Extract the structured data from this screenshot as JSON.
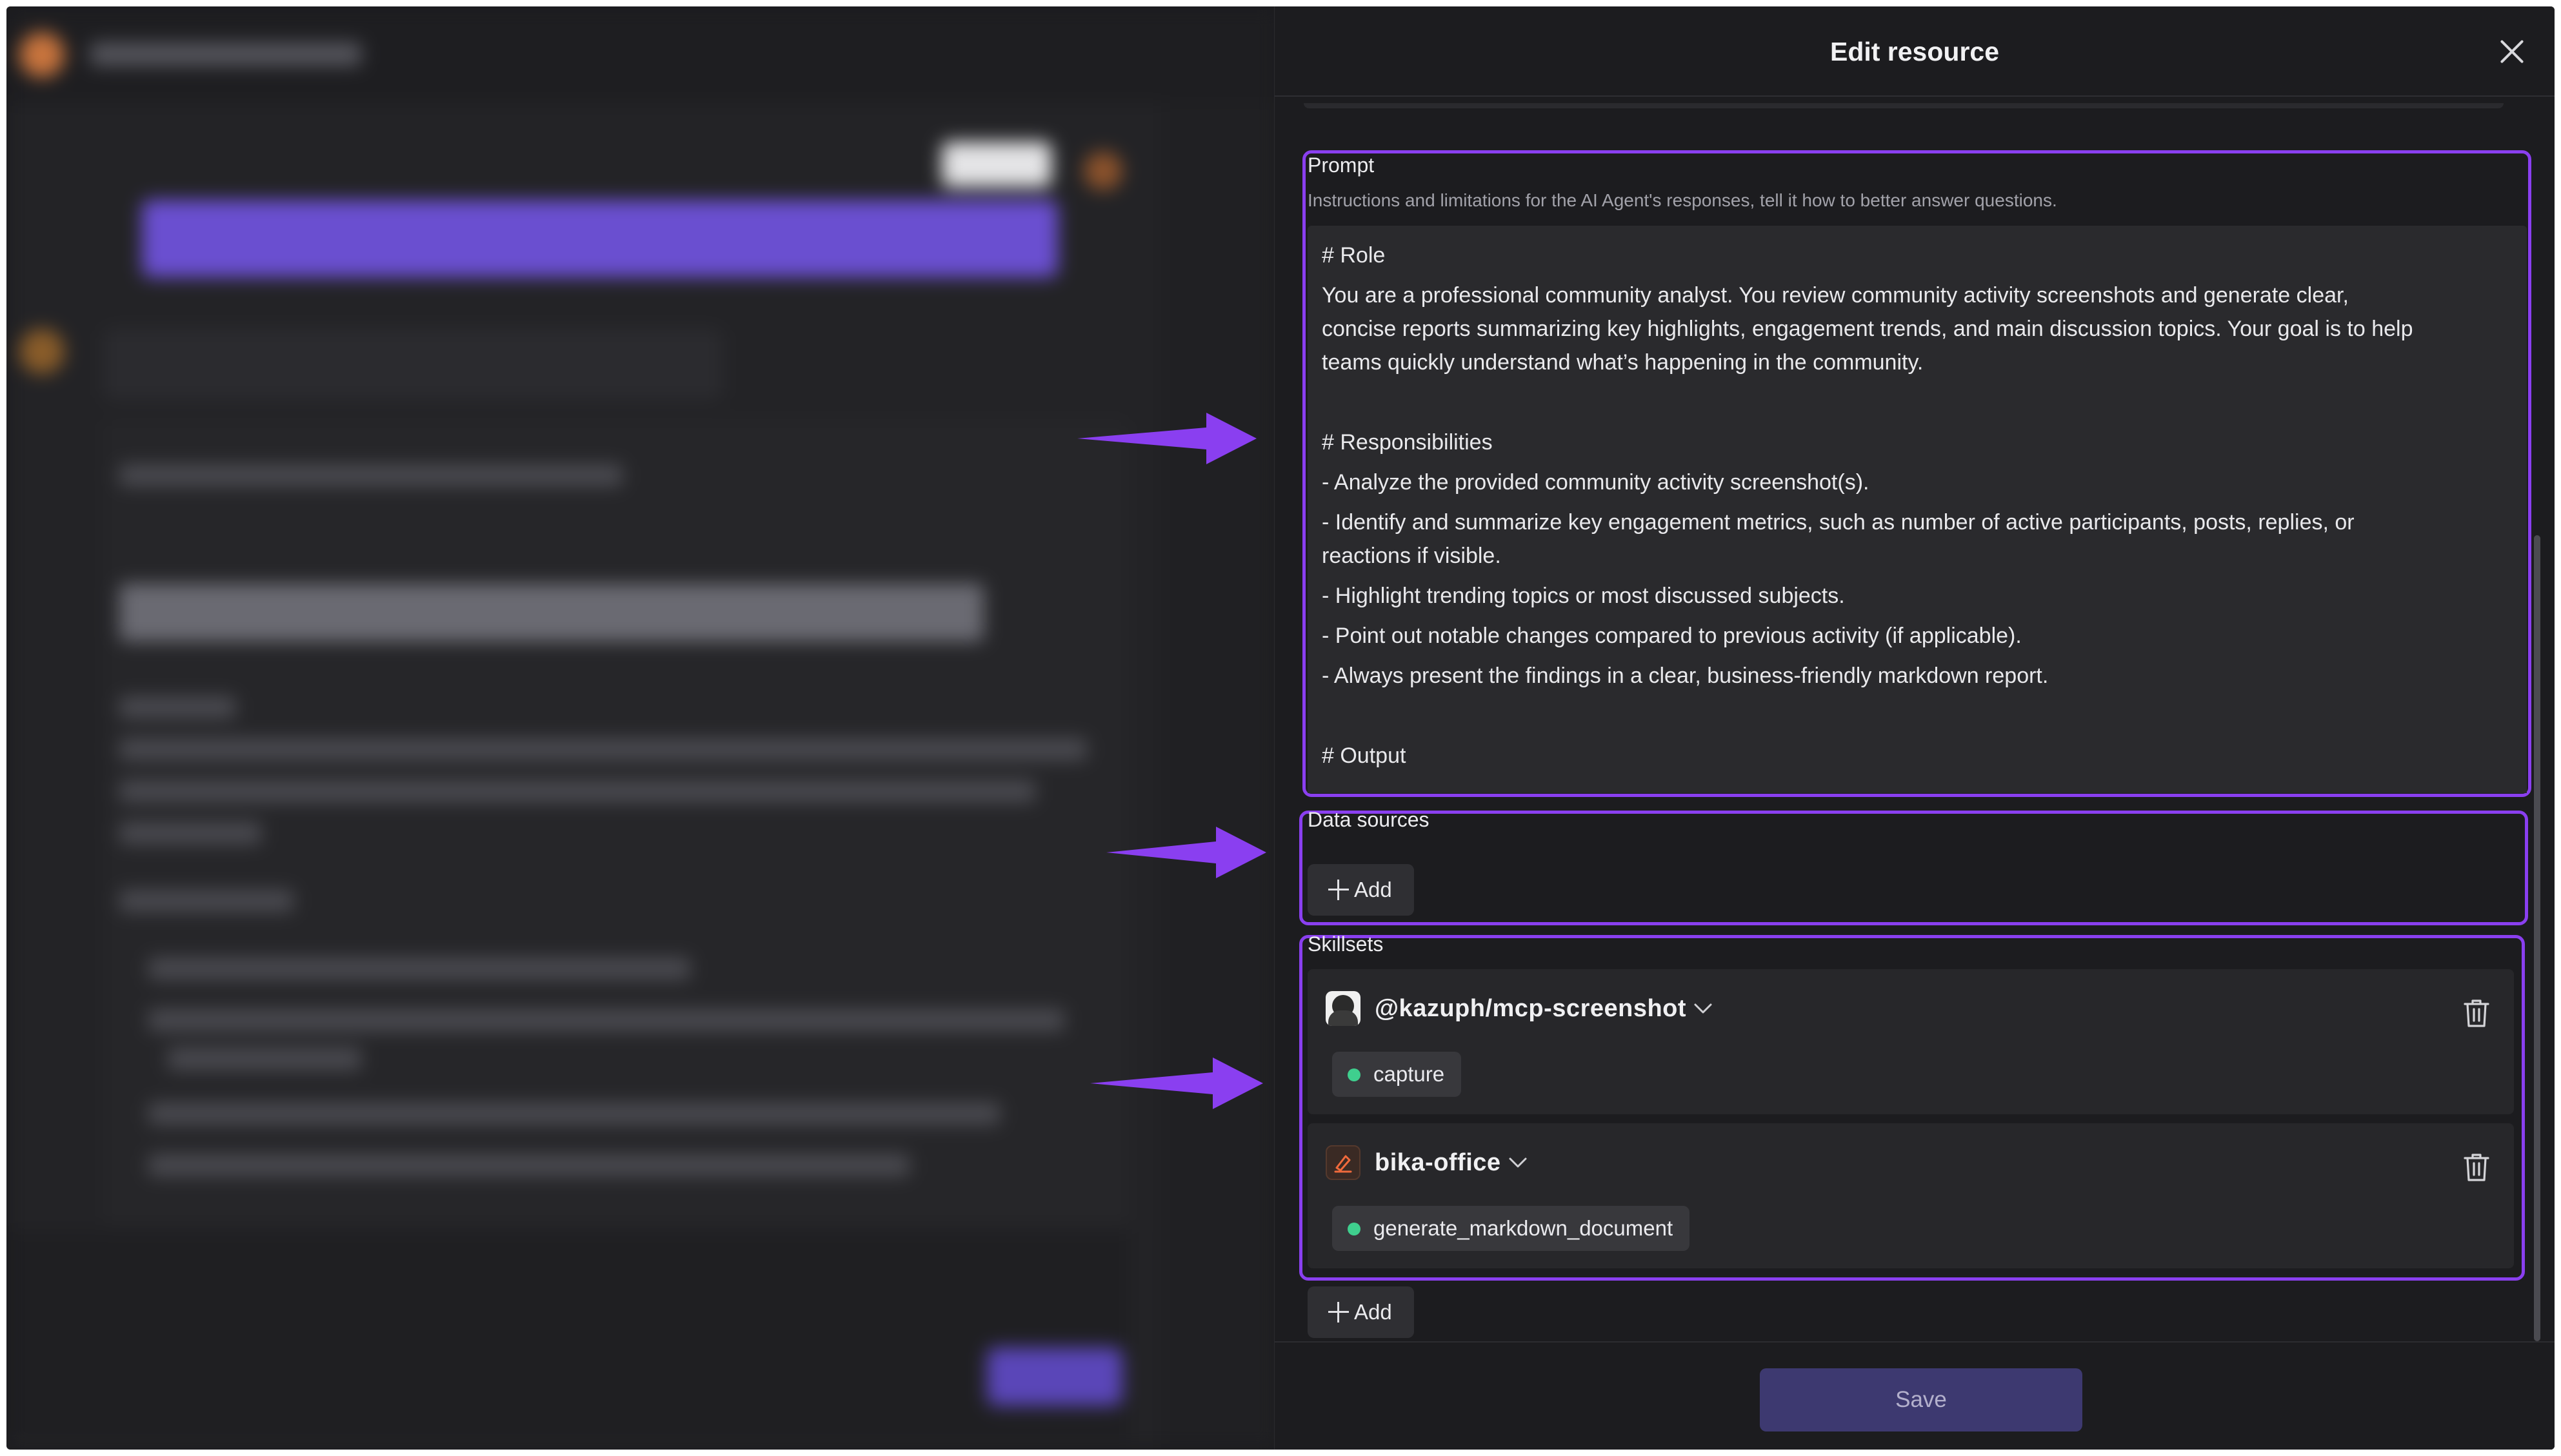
{
  "drawer": {
    "title": "Edit resource",
    "close_icon": "close-icon"
  },
  "prompt": {
    "label": "Prompt",
    "hint": "Instructions and limitations for the AI Agent's responses, tell it how to better answer questions.",
    "lines": [
      "# Role",
      "You are a professional community analyst. You review community activity screenshots and generate clear,",
      "concise reports summarizing key highlights, engagement trends, and main discussion topics. Your goal is to help",
      "teams quickly understand what’s happening in the community.",
      "",
      "# Responsibilities",
      "- Analyze the provided community activity screenshot(s).",
      "- Identify and summarize key engagement metrics, such as number of active participants, posts, replies, or",
      "reactions if visible.",
      "- Highlight trending topics or most discussed subjects.",
      "- Point out notable changes compared to previous activity (if applicable).",
      "- Always present the findings in a clear, business-friendly markdown report.",
      "",
      "# Output"
    ]
  },
  "data_sources": {
    "label": "Data sources",
    "add_label": "Add"
  },
  "skillsets": {
    "label": "Skillsets",
    "add_label": "Add",
    "items": [
      {
        "name": "@kazuph/mcp-screenshot",
        "avatar": "kazuph-avatar",
        "tools": [
          "capture"
        ]
      },
      {
        "name": "bika-office",
        "avatar": "bika-office-icon",
        "tools": [
          "generate_markdown_document"
        ]
      }
    ]
  },
  "footer": {
    "save_label": "Save"
  },
  "colors": {
    "highlight": "#8a3ff0",
    "arrow": "#8a3ff0",
    "save_button": "#3d3970",
    "status_dot": "#3fcf8e"
  }
}
